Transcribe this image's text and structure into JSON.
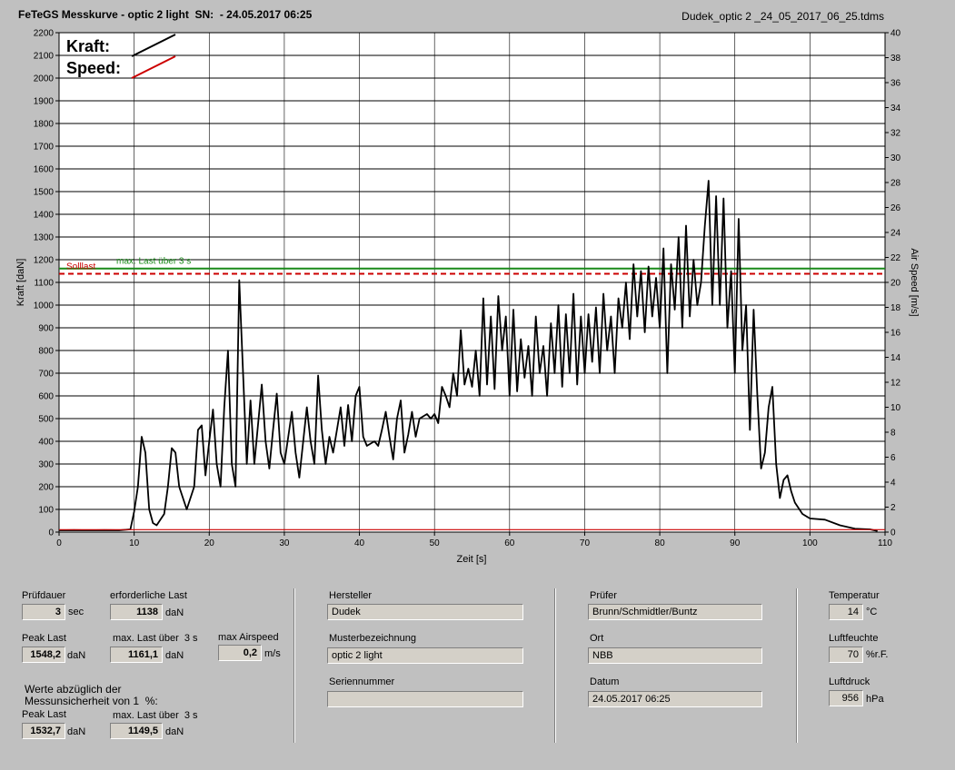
{
  "title": {
    "left": "FeTeGS Messkurve - optic 2 light  SN:  - 24.05.2017 06:25",
    "right": "Dudek_optic 2 _24_05_2017_06_25.tdms"
  },
  "chart_data": {
    "type": "line",
    "xlabel": "Zeit [s]",
    "ylabel": "Kraft [daN]",
    "y2label": "Air Speed [m/s]",
    "xlim": [
      0,
      110
    ],
    "ylim": [
      0,
      2200
    ],
    "y2lim": [
      0,
      40
    ],
    "x_ticks": [
      0,
      10,
      20,
      30,
      40,
      50,
      60,
      70,
      80,
      90,
      100,
      110
    ],
    "y_ticks": [
      0,
      100,
      200,
      300,
      400,
      500,
      600,
      700,
      800,
      900,
      1000,
      1100,
      1200,
      1300,
      1400,
      1500,
      1600,
      1700,
      1800,
      1900,
      2000,
      2100,
      2200
    ],
    "y2_ticks": [
      0,
      2,
      4,
      6,
      8,
      10,
      12,
      14,
      16,
      18,
      20,
      22,
      24,
      26,
      28,
      30,
      32,
      34,
      36,
      38,
      40
    ],
    "grid": "horizontal+vertical",
    "legend": {
      "position": "top-left",
      "entries": [
        {
          "label": "Kraft:",
          "color": "#000000"
        },
        {
          "label": "Speed:",
          "color": "#cc0000"
        }
      ]
    },
    "reference_lines": [
      {
        "label": "max. Last über  3 s",
        "y": 1161.1,
        "color": "#1a8a1a",
        "style": "solid"
      },
      {
        "label": "Solllast",
        "y": 1138,
        "color": "#cc0000",
        "style": "dashed"
      }
    ],
    "series": [
      {
        "name": "Kraft",
        "color": "#000000",
        "points": [
          [
            0,
            8
          ],
          [
            2,
            9
          ],
          [
            4,
            8
          ],
          [
            6,
            9
          ],
          [
            8,
            8
          ],
          [
            9.5,
            12
          ],
          [
            10,
            90
          ],
          [
            10.5,
            200
          ],
          [
            11,
            420
          ],
          [
            11.5,
            350
          ],
          [
            12,
            100
          ],
          [
            12.5,
            40
          ],
          [
            13,
            30
          ],
          [
            14,
            80
          ],
          [
            14.5,
            200
          ],
          [
            15,
            370
          ],
          [
            15.5,
            350
          ],
          [
            16,
            200
          ],
          [
            17,
            100
          ],
          [
            18,
            200
          ],
          [
            18.5,
            450
          ],
          [
            19,
            470
          ],
          [
            19.5,
            250
          ],
          [
            20,
            400
          ],
          [
            20.5,
            540
          ],
          [
            21,
            300
          ],
          [
            21.5,
            200
          ],
          [
            22,
            550
          ],
          [
            22.5,
            800
          ],
          [
            23,
            300
          ],
          [
            23.5,
            200
          ],
          [
            24,
            1110
          ],
          [
            24.5,
            700
          ],
          [
            25,
            300
          ],
          [
            25.5,
            580
          ],
          [
            26,
            300
          ],
          [
            27,
            650
          ],
          [
            27.5,
            400
          ],
          [
            28,
            280
          ],
          [
            28.5,
            450
          ],
          [
            29,
            610
          ],
          [
            29.5,
            350
          ],
          [
            30,
            300
          ],
          [
            31,
            530
          ],
          [
            31.5,
            350
          ],
          [
            32,
            240
          ],
          [
            33,
            550
          ],
          [
            33.5,
            400
          ],
          [
            34,
            300
          ],
          [
            34.5,
            690
          ],
          [
            35,
            450
          ],
          [
            35.5,
            300
          ],
          [
            36,
            420
          ],
          [
            36.5,
            350
          ],
          [
            37,
            450
          ],
          [
            37.5,
            550
          ],
          [
            38,
            380
          ],
          [
            38.5,
            560
          ],
          [
            39,
            400
          ],
          [
            39.5,
            600
          ],
          [
            40,
            640
          ],
          [
            40.5,
            420
          ],
          [
            41,
            380
          ],
          [
            42,
            400
          ],
          [
            42.5,
            380
          ],
          [
            43,
            450
          ],
          [
            43.5,
            530
          ],
          [
            44,
            420
          ],
          [
            44.5,
            320
          ],
          [
            45,
            500
          ],
          [
            45.5,
            580
          ],
          [
            46,
            350
          ],
          [
            46.5,
            430
          ],
          [
            47,
            530
          ],
          [
            47.5,
            420
          ],
          [
            48,
            500
          ],
          [
            49,
            520
          ],
          [
            49.5,
            500
          ],
          [
            50,
            520
          ],
          [
            50.5,
            480
          ],
          [
            51,
            640
          ],
          [
            51.5,
            600
          ],
          [
            52,
            550
          ],
          [
            52.5,
            700
          ],
          [
            53,
            600
          ],
          [
            53.5,
            890
          ],
          [
            54,
            650
          ],
          [
            54.5,
            720
          ],
          [
            55,
            640
          ],
          [
            55.5,
            800
          ],
          [
            56,
            600
          ],
          [
            56.5,
            1030
          ],
          [
            57,
            650
          ],
          [
            57.5,
            950
          ],
          [
            58,
            630
          ],
          [
            58.5,
            1040
          ],
          [
            59,
            800
          ],
          [
            59.5,
            950
          ],
          [
            60,
            600
          ],
          [
            60.5,
            980
          ],
          [
            61,
            620
          ],
          [
            61.5,
            850
          ],
          [
            62,
            680
          ],
          [
            62.5,
            820
          ],
          [
            63,
            600
          ],
          [
            63.5,
            950
          ],
          [
            64,
            700
          ],
          [
            64.5,
            820
          ],
          [
            65,
            600
          ],
          [
            65.5,
            920
          ],
          [
            66,
            700
          ],
          [
            66.5,
            1000
          ],
          [
            67,
            640
          ],
          [
            67.5,
            960
          ],
          [
            68,
            700
          ],
          [
            68.5,
            1050
          ],
          [
            69,
            650
          ],
          [
            69.5,
            950
          ],
          [
            70,
            700
          ],
          [
            70.5,
            960
          ],
          [
            71,
            750
          ],
          [
            71.5,
            990
          ],
          [
            72,
            700
          ],
          [
            72.5,
            1050
          ],
          [
            73,
            800
          ],
          [
            73.5,
            950
          ],
          [
            74,
            700
          ],
          [
            74.5,
            1030
          ],
          [
            75,
            900
          ],
          [
            75.5,
            1100
          ],
          [
            76,
            850
          ],
          [
            76.5,
            1180
          ],
          [
            77,
            950
          ],
          [
            77.5,
            1150
          ],
          [
            78,
            880
          ],
          [
            78.5,
            1170
          ],
          [
            79,
            950
          ],
          [
            79.5,
            1120
          ],
          [
            80,
            900
          ],
          [
            80.5,
            1250
          ],
          [
            81,
            700
          ],
          [
            81.5,
            1180
          ],
          [
            82,
            980
          ],
          [
            82.5,
            1300
          ],
          [
            83,
            900
          ],
          [
            83.5,
            1350
          ],
          [
            84,
            950
          ],
          [
            84.5,
            1200
          ],
          [
            85,
            1000
          ],
          [
            85.5,
            1100
          ],
          [
            86,
            1350
          ],
          [
            86.5,
            1548
          ],
          [
            87,
            1000
          ],
          [
            87.5,
            1480
          ],
          [
            88,
            1000
          ],
          [
            88.5,
            1470
          ],
          [
            89,
            900
          ],
          [
            89.5,
            1150
          ],
          [
            90,
            700
          ],
          [
            90.5,
            1380
          ],
          [
            91,
            800
          ],
          [
            91.5,
            1000
          ],
          [
            92,
            450
          ],
          [
            92.5,
            980
          ],
          [
            93,
            600
          ],
          [
            93.5,
            280
          ],
          [
            94,
            350
          ],
          [
            94.5,
            550
          ],
          [
            95,
            640
          ],
          [
            95.5,
            300
          ],
          [
            96,
            150
          ],
          [
            96.5,
            230
          ],
          [
            97,
            250
          ],
          [
            97.5,
            180
          ],
          [
            98,
            130
          ],
          [
            99,
            80
          ],
          [
            100,
            60
          ],
          [
            102,
            55
          ],
          [
            104,
            30
          ],
          [
            106,
            15
          ],
          [
            108,
            12
          ],
          [
            109,
            5
          ]
        ]
      },
      {
        "name": "Speed",
        "color": "#cc0000",
        "points": [
          [
            0,
            0.2
          ],
          [
            110,
            0.2
          ]
        ]
      }
    ]
  },
  "panel": {
    "pruefdauer": {
      "label": "Prüfdauer",
      "value": "3",
      "unit": "sec"
    },
    "erforderliche_last": {
      "label": "erforderliche Last",
      "value": "1138",
      "unit": "daN"
    },
    "peak_last": {
      "label": "Peak Last",
      "value": "1548,2",
      "unit": "daN"
    },
    "max_last": {
      "label": "max. Last über  3 s",
      "value": "1161,1",
      "unit": "daN"
    },
    "max_airspeed": {
      "label": "max Airspeed",
      "value": "0,2",
      "unit": "m/s"
    },
    "werte_text": "Werte abzüglich der\nMessunsicherheit von 1  %:",
    "peak_last_korr": {
      "label": "Peak Last",
      "value": "1532,7",
      "unit": "daN"
    },
    "max_last_korr": {
      "label": "max. Last über  3 s",
      "value": "1149,5",
      "unit": "daN"
    },
    "hersteller": {
      "label": "Hersteller",
      "value": "Dudek"
    },
    "musterbezeichnung": {
      "label": "Musterbezeichnung",
      "value": "optic 2 light"
    },
    "seriennummer": {
      "label": "Seriennummer",
      "value": ""
    },
    "pruefer": {
      "label": "Prüfer",
      "value": "Brunn/Schmidtler/Buntz"
    },
    "ort": {
      "label": "Ort",
      "value": "NBB"
    },
    "datum": {
      "label": "Datum",
      "value": "24.05.2017 06:25"
    },
    "temperatur": {
      "label": "Temperatur",
      "value": "14",
      "unit": "°C"
    },
    "luftfeuchte": {
      "label": "Luftfeuchte",
      "value": "70",
      "unit": "%r.F."
    },
    "luftdruck": {
      "label": "Luftdruck",
      "value": "956",
      "unit": "hPa"
    }
  }
}
